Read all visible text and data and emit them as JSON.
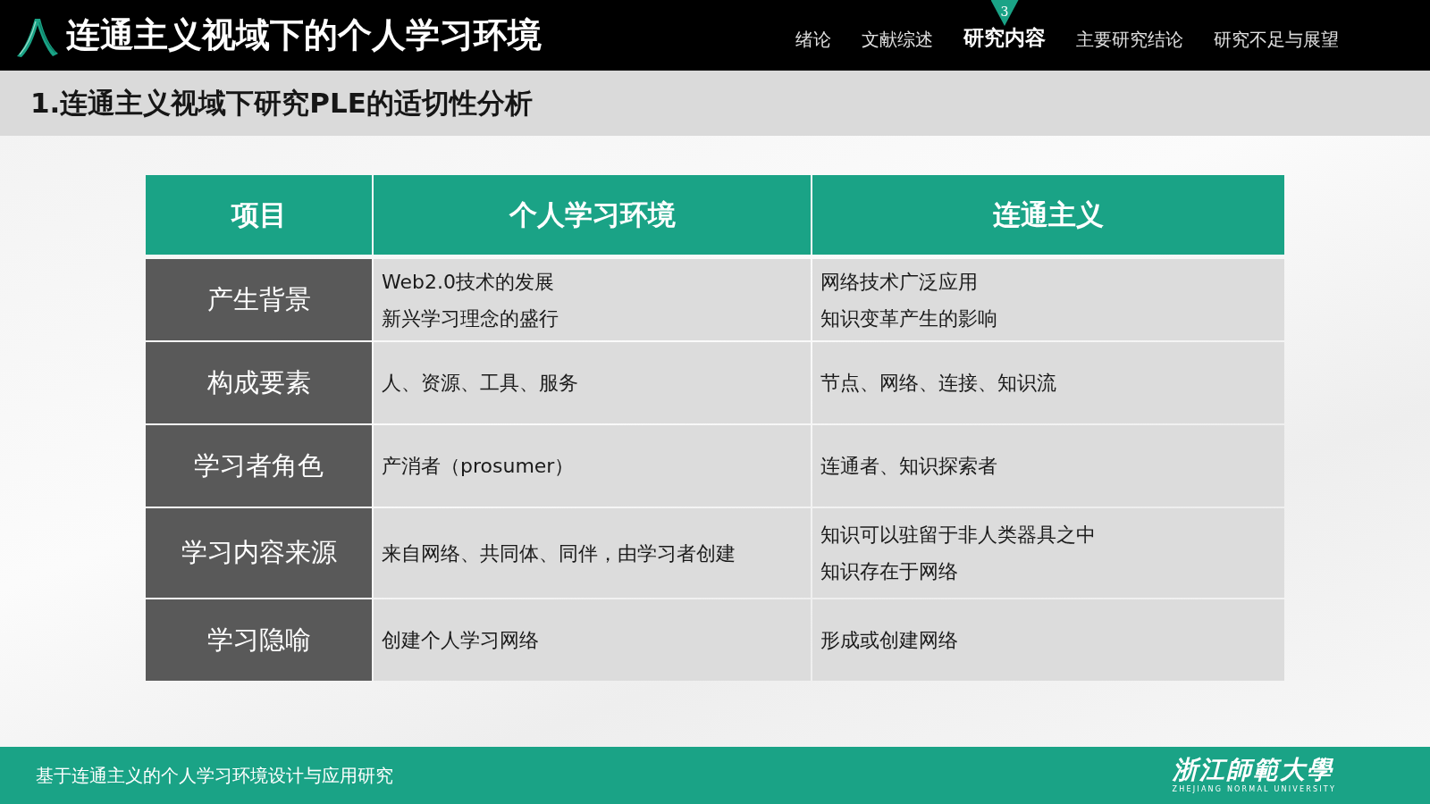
{
  "header": {
    "title": "连通主义视域下的个人学习环境",
    "nav": [
      {
        "label": "绪论",
        "selected": false
      },
      {
        "label": "文献综述",
        "selected": false
      },
      {
        "label": "研究内容",
        "selected": true,
        "badge": "3"
      },
      {
        "label": "主要研究结论",
        "selected": false
      },
      {
        "label": "研究不足与展望",
        "selected": false
      }
    ]
  },
  "section_heading": "1.连通主义视域下研究PLE的适切性分析",
  "table": {
    "columns": [
      "项目",
      "个人学习环境",
      "连通主义"
    ],
    "rows": [
      {
        "label": "产生背景",
        "cells": [
          [
            "Web2.0技术的发展",
            "新兴学习理念的盛行"
          ],
          [
            "网络技术广泛应用",
            "知识变革产生的影响"
          ]
        ]
      },
      {
        "label": "构成要素",
        "cells": [
          [
            "人、资源、工具、服务"
          ],
          [
            "节点、网络、连接、知识流"
          ]
        ]
      },
      {
        "label": "学习者角色",
        "cells": [
          [
            "产消者（prosumer）"
          ],
          [
            "连通者、知识探索者"
          ]
        ]
      },
      {
        "label": "学习内容来源",
        "cells": [
          [
            "来自网络、共同体、同伴，由学习者创建"
          ],
          [
            "知识可以驻留于非人类器具之中",
            "知识存在于网络"
          ]
        ]
      },
      {
        "label": "学习隐喻",
        "cells": [
          [
            "创建个人学习网络"
          ],
          [
            "形成或创建网络"
          ]
        ]
      }
    ]
  },
  "footer": {
    "text": "基于连通主义的个人学习环境设计与应用研究",
    "logo": {
      "name": "浙江師範大學",
      "name_english": "ZHEJIANG NORMAL UNIVERSITY"
    }
  }
}
